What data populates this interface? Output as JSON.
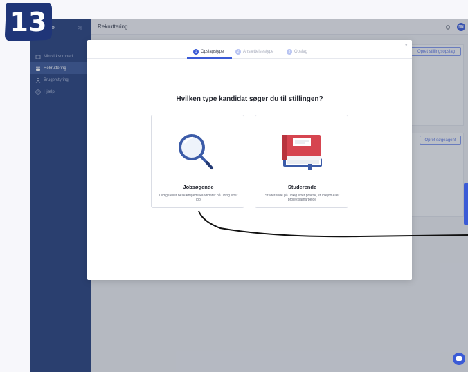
{
  "step_badge": {
    "number": "13"
  },
  "sidebar": {
    "logo": "o",
    "items": [
      {
        "label": "Min virksomhed",
        "icon": "building-icon",
        "active": false
      },
      {
        "label": "Rekruttering",
        "icon": "people-icon",
        "active": true
      },
      {
        "label": "Brugerstyring",
        "icon": "users-icon",
        "active": false
      },
      {
        "label": "Hjælp",
        "icon": "help-icon",
        "active": false
      }
    ]
  },
  "topbar": {
    "title": "Rekruttering",
    "avatar_initials": "NN"
  },
  "background": {
    "create_posting_button": "Opret stillingsopslag",
    "create_agent_button": "Opret søgeagent"
  },
  "modal": {
    "close_label": "×",
    "steps": [
      {
        "number": "1",
        "label": "Opslagstype",
        "active": true
      },
      {
        "number": "2",
        "label": "Ansættelsestype",
        "active": false
      },
      {
        "number": "3",
        "label": "Opslag",
        "active": false
      }
    ],
    "question": "Hvilken type kandidat søger du til stillingen?",
    "options": [
      {
        "title": "Jobsøgende",
        "description": "Ledige eller beskæftigede kandidater på udkig efter job",
        "icon": "magnifier-icon"
      },
      {
        "title": "Studerende",
        "description": "Studerende på udkig efter praktik, studiejob eller projektsamarbejde",
        "icon": "books-icon"
      }
    ]
  },
  "colors": {
    "accent": "#3b5bd6",
    "sidebar": "#28407c",
    "badge": "#1f3578"
  }
}
